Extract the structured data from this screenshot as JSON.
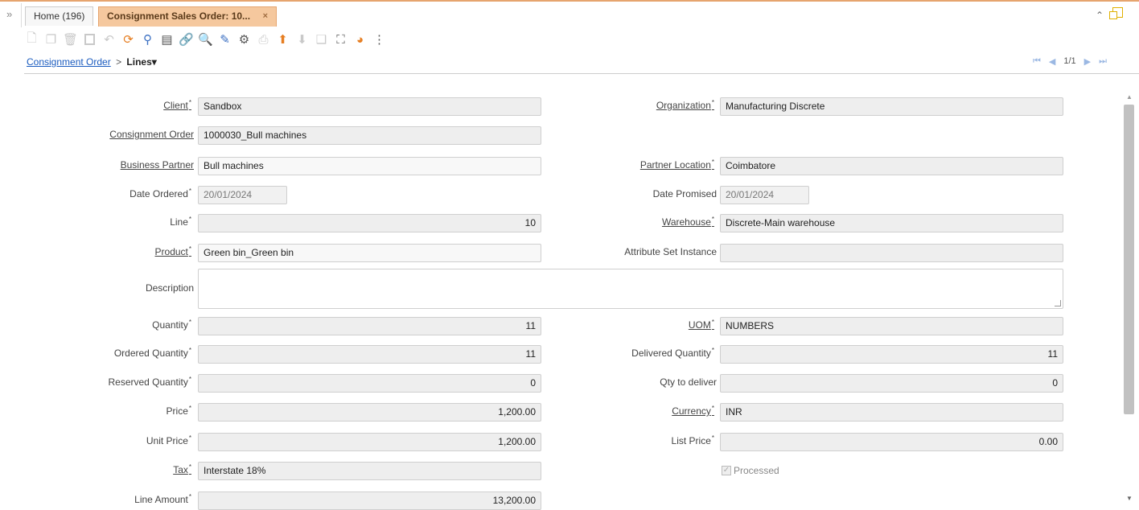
{
  "tabs": {
    "expand_glyph": "»",
    "home_label": "Home (196)",
    "active_label": "Consignment Sales Order: 10...",
    "close_glyph": "×",
    "maximize_glyph": "⌃"
  },
  "toolbar": {
    "icons": [
      "new-record-icon",
      "copy-icon",
      "delete-icon",
      "save-icon",
      "undo-icon",
      "refresh-icon",
      "find-icon",
      "grid-toggle-icon",
      "attachment-icon",
      "zoom-icon",
      "edit-icon",
      "process-icon",
      "print-icon",
      "parent-record-icon",
      "next-record-icon",
      "report-icon",
      "workflow-icon",
      "help-icon",
      "more-icon"
    ]
  },
  "breadcrumb": {
    "parent": "Consignment Order",
    "separator": ">",
    "current": "Lines▾"
  },
  "navigation": {
    "record_count": "1/1"
  },
  "form": {
    "client": {
      "label": "Client",
      "value": "Sandbox"
    },
    "organization": {
      "label": "Organization",
      "value": "Manufacturing Discrete"
    },
    "consignment_order": {
      "label": "Consignment Order",
      "value": "1000030_Bull machines"
    },
    "business_partner": {
      "label": "Business Partner",
      "value": "Bull machines"
    },
    "partner_location": {
      "label": "Partner Location",
      "value": "Coimbatore"
    },
    "date_ordered": {
      "label": "Date Ordered",
      "value": "20/01/2024"
    },
    "date_promised": {
      "label": "Date Promised",
      "value": "20/01/2024"
    },
    "line": {
      "label": "Line",
      "value": "10"
    },
    "warehouse": {
      "label": "Warehouse",
      "value": "Discrete-Main warehouse"
    },
    "product": {
      "label": "Product",
      "value": "Green bin_Green bin"
    },
    "attribute_set_instance": {
      "label": "Attribute Set Instance",
      "value": ""
    },
    "description": {
      "label": "Description",
      "value": ""
    },
    "quantity": {
      "label": "Quantity",
      "value": "11"
    },
    "uom": {
      "label": "UOM",
      "value": "NUMBERS"
    },
    "ordered_quantity": {
      "label": "Ordered Quantity",
      "value": "11"
    },
    "delivered_quantity": {
      "label": "Delivered Quantity",
      "value": "11"
    },
    "reserved_quantity": {
      "label": "Reserved Quantity",
      "value": "0"
    },
    "qty_to_deliver": {
      "label": "Qty to deliver",
      "value": "0"
    },
    "price": {
      "label": "Price",
      "value": "1,200.00"
    },
    "currency": {
      "label": "Currency",
      "value": "INR"
    },
    "unit_price": {
      "label": "Unit Price",
      "value": "1,200.00"
    },
    "list_price": {
      "label": "List Price",
      "value": "0.00"
    },
    "tax": {
      "label": "Tax",
      "value": "Interstate 18%"
    },
    "processed": {
      "label": "Processed",
      "checked": true
    },
    "line_amount": {
      "label": "Line Amount",
      "value": "13,200.00"
    }
  },
  "colors": {
    "active_tab": "#f5c89e",
    "tab_border": "#e6a46e",
    "link": "#1a5bbf",
    "field_bg": "#eeeeee"
  }
}
